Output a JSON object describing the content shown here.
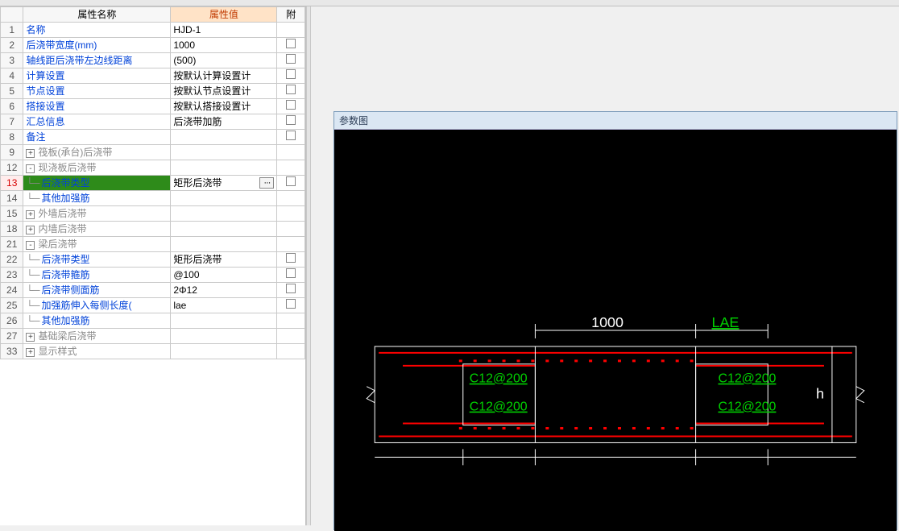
{
  "headers": {
    "name": "属性名称",
    "value": "属性值",
    "attach": "附"
  },
  "rows": [
    {
      "n": "1",
      "name": "名称",
      "val": "HJD-1",
      "cls": "blue",
      "chk": false
    },
    {
      "n": "2",
      "name": "后浇带宽度(mm)",
      "val": "1000",
      "cls": "blue",
      "chk": true
    },
    {
      "n": "3",
      "name": "轴线距后浇带左边线距离",
      "val": "(500)",
      "cls": "blue",
      "chk": true
    },
    {
      "n": "4",
      "name": "计算设置",
      "val": "按默认计算设置计",
      "cls": "blue",
      "chk": true
    },
    {
      "n": "5",
      "name": "节点设置",
      "val": "按默认节点设置计",
      "cls": "blue",
      "chk": true
    },
    {
      "n": "6",
      "name": "搭接设置",
      "val": "按默认搭接设置计",
      "cls": "blue",
      "chk": true
    },
    {
      "n": "7",
      "name": "汇总信息",
      "val": "后浇带加筋",
      "cls": "blue",
      "chk": true
    },
    {
      "n": "8",
      "name": "备注",
      "val": "",
      "cls": "blue",
      "chk": true
    },
    {
      "n": "9",
      "toggle": "+",
      "name": "筏板(承台)后浇带",
      "val": "",
      "cls": "gray",
      "chk": false
    },
    {
      "n": "12",
      "toggle": "-",
      "name": "现浇板后浇带",
      "val": "",
      "cls": "gray",
      "chk": false
    },
    {
      "n": "13",
      "indent": 1,
      "name": "后浇带类型",
      "val": "矩形后浇带",
      "cls": "blue",
      "chk": true,
      "selected": true,
      "editor": true
    },
    {
      "n": "14",
      "indent": 1,
      "name": "其他加强筋",
      "val": "",
      "cls": "blue",
      "chk": false
    },
    {
      "n": "15",
      "toggle": "+",
      "name": "外墙后浇带",
      "val": "",
      "cls": "gray",
      "chk": false
    },
    {
      "n": "18",
      "toggle": "+",
      "name": "内墙后浇带",
      "val": "",
      "cls": "gray",
      "chk": false
    },
    {
      "n": "21",
      "toggle": "-",
      "name": "梁后浇带",
      "val": "",
      "cls": "gray",
      "chk": false
    },
    {
      "n": "22",
      "indent": 1,
      "name": "后浇带类型",
      "val": "矩形后浇带",
      "cls": "blue",
      "chk": true
    },
    {
      "n": "23",
      "indent": 1,
      "name": "后浇带箍筋",
      "val": "@100",
      "cls": "blue",
      "chk": true
    },
    {
      "n": "24",
      "indent": 1,
      "name": "后浇带侧面筋",
      "val": "2Φ12",
      "cls": "blue",
      "chk": true
    },
    {
      "n": "25",
      "indent": 1,
      "name": "加强筋伸入每侧长度(",
      "val": "lae",
      "cls": "blue",
      "chk": true
    },
    {
      "n": "26",
      "indent": 1,
      "name": "其他加强筋",
      "val": "",
      "cls": "blue",
      "chk": false
    },
    {
      "n": "27",
      "toggle": "+",
      "name": "基础梁后浇带",
      "val": "",
      "cls": "gray",
      "chk": false
    },
    {
      "n": "33",
      "toggle": "+",
      "name": "显示样式",
      "val": "",
      "cls": "gray",
      "chk": false
    }
  ],
  "diagram": {
    "title": "参数图",
    "width_label": "1000",
    "lae_label": "LAE",
    "h_label": "h",
    "rebar_tags": [
      "C12@200",
      "C12@200",
      "C12@200",
      "C12@200"
    ]
  }
}
